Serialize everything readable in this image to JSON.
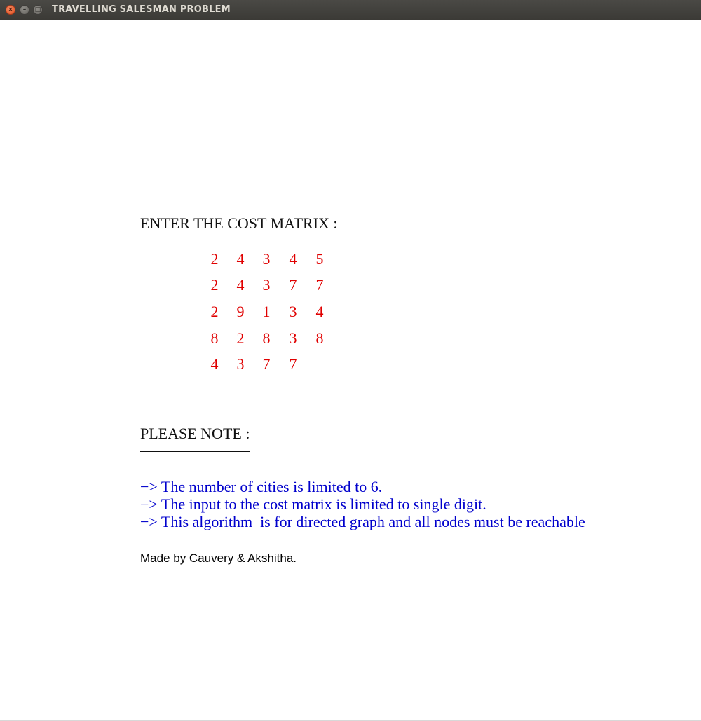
{
  "window": {
    "title": "TRAVELLING SALESMAN PROBLEM",
    "close_glyph": "×",
    "minimize_glyph": "–",
    "maximize_glyph": "□"
  },
  "matrix": {
    "heading": "ENTER THE COST MATRIX :",
    "rows": [
      [
        "2",
        "4",
        "3",
        "4",
        "5"
      ],
      [
        "2",
        "4",
        "3",
        "7",
        "7"
      ],
      [
        "2",
        "9",
        "1",
        "3",
        "4"
      ],
      [
        "8",
        "2",
        "8",
        "3",
        "8"
      ],
      [
        "4",
        "3",
        "7",
        "7"
      ]
    ]
  },
  "notes": {
    "heading": "PLEASE NOTE :",
    "items": [
      "−> The number of cities is limited to 6.",
      "−> The input to the cost matrix is limited to single digit.",
      "−> This algorithm  is for directed graph and all nodes must be reachable"
    ]
  },
  "credit": "Made by Cauvery & Akshitha.",
  "colors": {
    "matrix_text": "#e00000",
    "note_text": "#0000cc",
    "titlebar": "#3c3b37"
  }
}
